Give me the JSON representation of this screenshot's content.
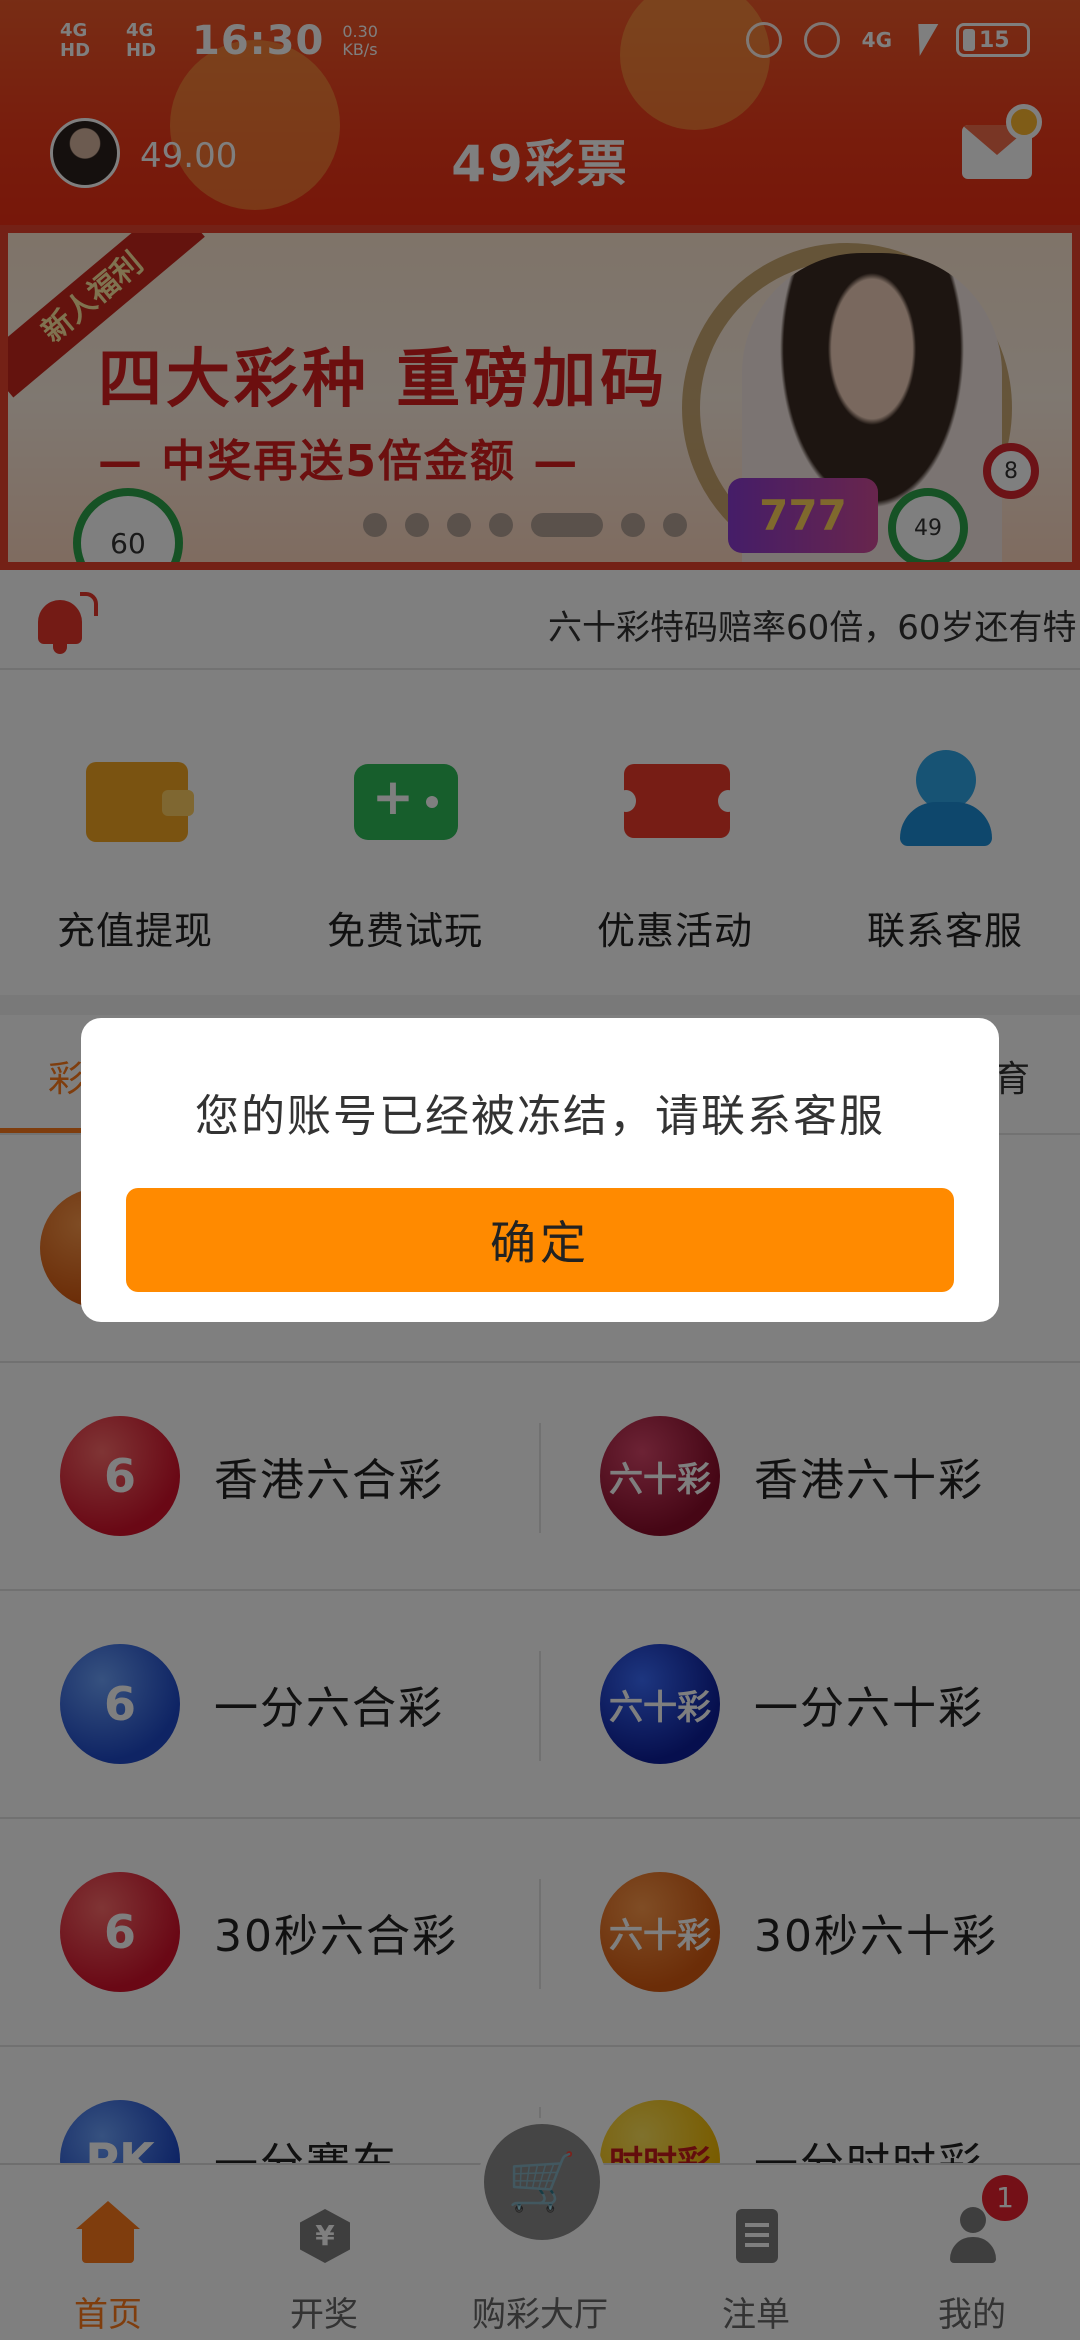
{
  "status_bar": {
    "signal_1": "4G HD",
    "signal_2": "4G HD",
    "time": "16:30",
    "speed": "0.30 KB/s",
    "network": "4G",
    "battery": "15"
  },
  "header": {
    "balance": "49.00",
    "title": "49彩票"
  },
  "banner": {
    "ribbon": "新人福利",
    "headline": "四大彩种 重磅加码",
    "subline": "— 中奖再送5倍金额 —",
    "ball_left": "60",
    "ball_right": "49",
    "ball_top": "8",
    "slot_text": "777",
    "active_dot": 4
  },
  "notice": {
    "text": "六十彩特码赔率60倍，60岁还有特"
  },
  "quick_menu": [
    {
      "label": "充值提现",
      "icon": "wallet-icon"
    },
    {
      "label": "免费试玩",
      "icon": "gamepad-icon"
    },
    {
      "label": "优惠活动",
      "icon": "ticket-icon"
    },
    {
      "label": "联系客服",
      "icon": "customer-service-icon"
    }
  ],
  "tabs": {
    "left": "彩",
    "right": "育"
  },
  "lotteries": [
    {
      "left": {
        "name": "",
        "logo": ""
      },
      "right": {
        "name": "",
        "logo": ""
      }
    },
    {
      "left": {
        "name": "香港六合彩",
        "logo": "6"
      },
      "right": {
        "name": "香港六十彩",
        "logo": "六十彩"
      }
    },
    {
      "left": {
        "name": "一分六合彩",
        "logo": "6"
      },
      "right": {
        "name": "一分六十彩",
        "logo": "六十彩"
      }
    },
    {
      "left": {
        "name": "30秒六合彩",
        "logo": "6"
      },
      "right": {
        "name": "30秒六十彩",
        "logo": "六十彩"
      }
    },
    {
      "left": {
        "name": "一分赛车",
        "logo": "PK"
      },
      "right": {
        "name": "一分时时彩",
        "logo": "时时彩"
      }
    }
  ],
  "bottom_nav": [
    {
      "label": "首页",
      "icon": "home-icon"
    },
    {
      "label": "开奖",
      "icon": "draw-results-icon"
    },
    {
      "label": "购彩大厅",
      "icon": "cart-icon"
    },
    {
      "label": "注单",
      "icon": "orders-icon"
    },
    {
      "label": "我的",
      "icon": "user-icon"
    }
  ],
  "nav_badge": "1",
  "dialog": {
    "message": "您的账号已经被冻结，请联系客服",
    "confirm": "确定"
  },
  "colors": {
    "header": "#f03a1a",
    "accent": "#ff8a00",
    "badge": "#e9202e"
  }
}
